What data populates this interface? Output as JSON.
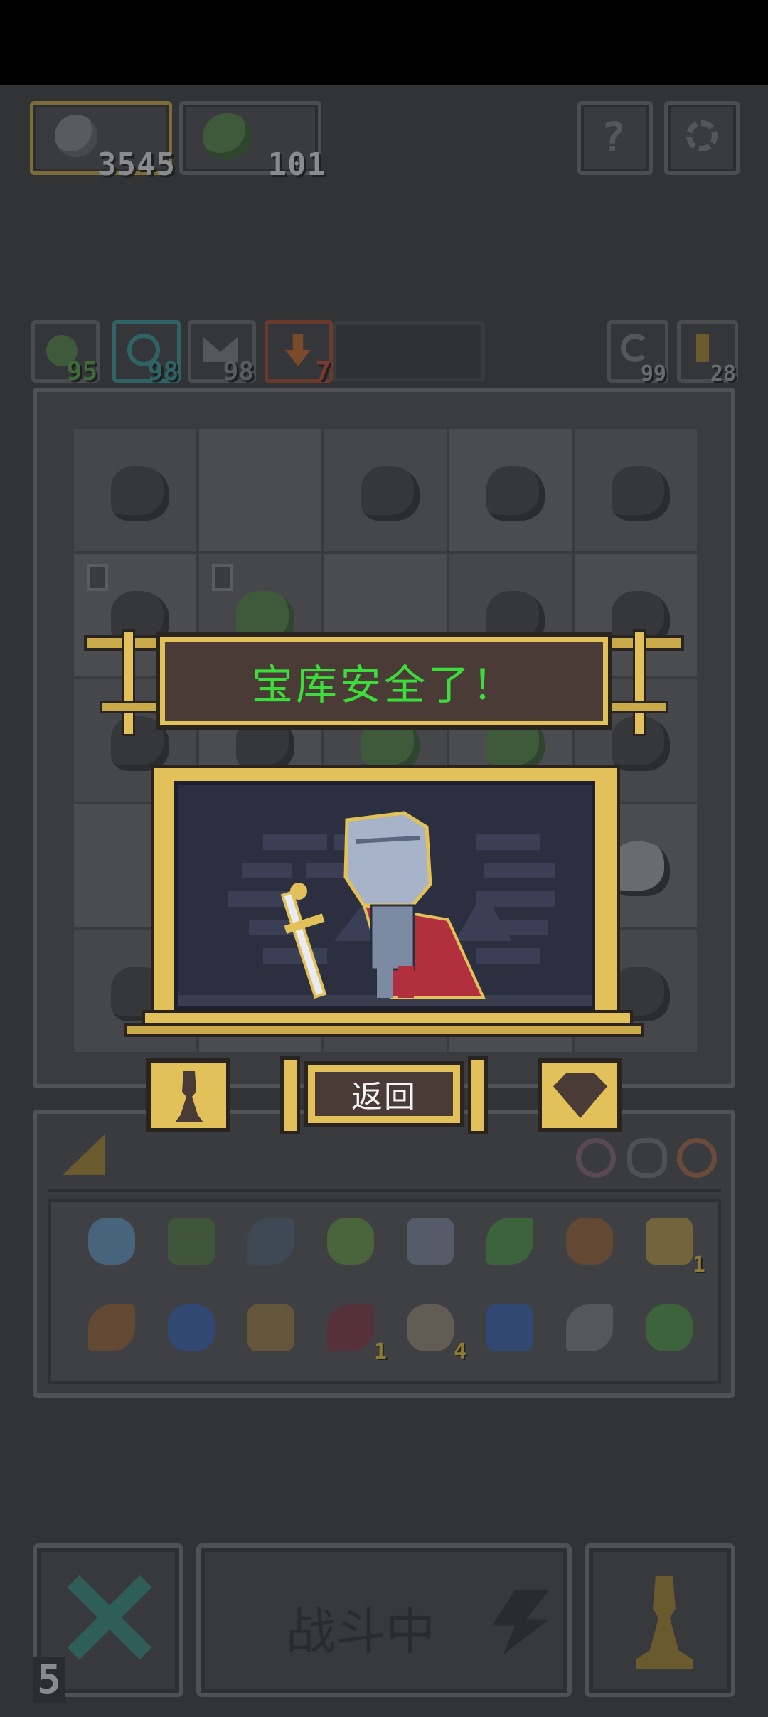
{
  "header": {
    "currency_gold": "3545",
    "currency_gems": "101"
  },
  "stats": {
    "green": "95",
    "cyan": "98",
    "gray": "98",
    "red": "7",
    "right_a": "99",
    "right_b": "28"
  },
  "popup": {
    "title": "宝库安全了！",
    "back_label": "返回"
  },
  "inventory": {
    "items": [
      {
        "icon": "crystal-icon",
        "qty": ""
      },
      {
        "icon": "green-helmet-icon",
        "qty": ""
      },
      {
        "icon": "shield-icon",
        "qty": ""
      },
      {
        "icon": "arrow-icon",
        "qty": ""
      },
      {
        "icon": "mirror-icon",
        "qty": ""
      },
      {
        "icon": "leaf-spear-icon",
        "qty": ""
      },
      {
        "icon": "boomerang-icon",
        "qty": ""
      },
      {
        "icon": "potion-jar-icon",
        "qty": "1"
      },
      {
        "icon": "feather-icon",
        "qty": ""
      },
      {
        "icon": "blue-scarf-icon",
        "qty": ""
      },
      {
        "icon": "fence-icon",
        "qty": ""
      },
      {
        "icon": "demon-mask-icon",
        "qty": "1"
      },
      {
        "icon": "scroll-icon",
        "qty": "4"
      },
      {
        "icon": "water-drop-icon",
        "qty": ""
      },
      {
        "icon": "hook-icon",
        "qty": ""
      },
      {
        "icon": "green-sword-icon",
        "qty": ""
      }
    ]
  },
  "bottom": {
    "turns": "5",
    "battle_label": "战斗中"
  },
  "colors": {
    "gold": "#e2c05a",
    "banner_bg": "#4a3b36",
    "title_green": "#3cdc3c",
    "background": "#323335"
  }
}
